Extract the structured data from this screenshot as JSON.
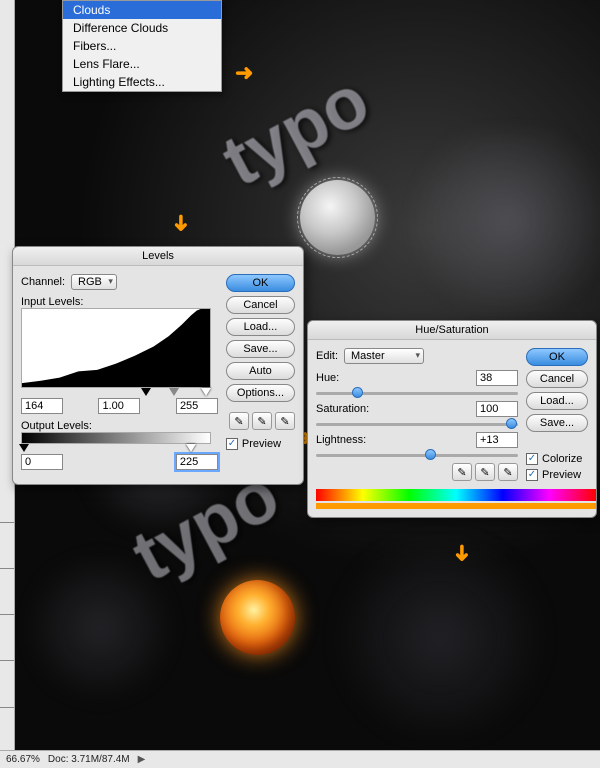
{
  "menu": {
    "items": [
      "Clouds",
      "Difference Clouds",
      "Fibers...",
      "Lens Flare...",
      "Lighting Effects..."
    ],
    "selected_index": 0
  },
  "typo_text": "typo",
  "arrows": {
    "glyph_right": "➜",
    "glyph_down": "↓"
  },
  "levels": {
    "title": "Levels",
    "channel_label": "Channel:",
    "channel_value": "RGB",
    "input_label": "Input Levels:",
    "input_black": "164",
    "input_mid": "1.00",
    "input_white": "255",
    "output_label": "Output Levels:",
    "output_black": "0",
    "output_white": "225",
    "buttons": {
      "ok": "OK",
      "cancel": "Cancel",
      "load": "Load...",
      "save": "Save...",
      "auto": "Auto",
      "options": "Options..."
    },
    "preview_label": "Preview"
  },
  "huesat": {
    "title": "Hue/Saturation",
    "edit_label": "Edit:",
    "edit_value": "Master",
    "hue_label": "Hue:",
    "hue_value": "38",
    "sat_label": "Saturation:",
    "sat_value": "100",
    "light_label": "Lightness:",
    "light_value": "+13",
    "colorize_label": "Colorize",
    "preview_label": "Preview",
    "buttons": {
      "ok": "OK",
      "cancel": "Cancel",
      "load": "Load...",
      "save": "Save..."
    }
  },
  "status": {
    "zoom": "66.67%",
    "doc": "Doc: 3.71M/87.4M",
    "arrow": "▶"
  }
}
